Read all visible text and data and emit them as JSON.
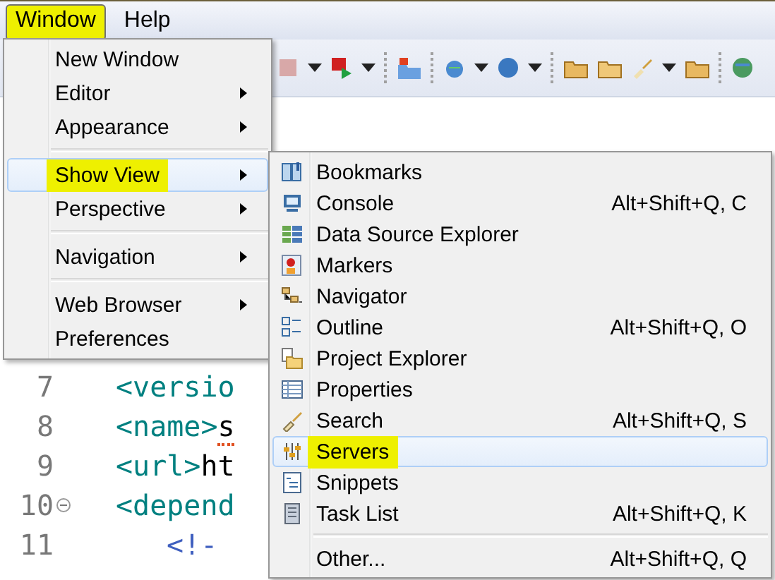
{
  "menubar": [
    {
      "label": "Window",
      "selected": true,
      "highlighted": true
    },
    {
      "label": "Help",
      "selected": false,
      "highlighted": false
    }
  ],
  "editor": {
    "lines": [
      {
        "number": "7",
        "tag": "<versio"
      },
      {
        "number": "8",
        "tag": "<name>",
        "text": "s",
        "squiggle": true
      },
      {
        "number": "9",
        "tag": "<url>",
        "text": "ht",
        "squiggle": false
      },
      {
        "number": "10",
        "tag": "<depend",
        "folded": true,
        "children": [
          {
            "number": "11",
            "tag": "<!-",
            "comment": true
          }
        ]
      }
    ]
  },
  "window_menu": {
    "items": [
      {
        "kind": "item",
        "label": "New Window",
        "submenu": false,
        "selected": false,
        "highlighted": false
      },
      {
        "kind": "item",
        "label": "Editor",
        "submenu": true,
        "selected": false,
        "highlighted": false
      },
      {
        "kind": "item",
        "label": "Appearance",
        "submenu": true,
        "selected": false,
        "highlighted": false
      },
      {
        "kind": "separator"
      },
      {
        "kind": "item",
        "label": "Show View",
        "submenu": true,
        "selected": true,
        "highlighted": true
      },
      {
        "kind": "item",
        "label": "Perspective",
        "submenu": true,
        "selected": false,
        "highlighted": false
      },
      {
        "kind": "separator"
      },
      {
        "kind": "item",
        "label": "Navigation",
        "submenu": true,
        "selected": false,
        "highlighted": false
      },
      {
        "kind": "separator"
      },
      {
        "kind": "item",
        "label": "Web Browser",
        "submenu": true,
        "selected": false,
        "highlighted": false
      },
      {
        "kind": "item",
        "label": "Preferences",
        "submenu": false,
        "selected": false,
        "highlighted": false
      }
    ]
  },
  "show_view_menu": {
    "items": [
      {
        "kind": "item",
        "label": "Bookmarks",
        "selected": false,
        "highlighted": false
      },
      {
        "kind": "item",
        "label": "Console",
        "shortcut": "Alt+Shift+Q, C",
        "selected": false,
        "highlighted": false
      },
      {
        "kind": "item",
        "label": "Data Source Explorer",
        "selected": false,
        "highlighted": false
      },
      {
        "kind": "item",
        "label": "Markers",
        "selected": false,
        "highlighted": false
      },
      {
        "kind": "item",
        "label": "Navigator",
        "selected": false,
        "highlighted": false
      },
      {
        "kind": "item",
        "label": "Outline",
        "shortcut": "Alt+Shift+Q, O",
        "selected": false,
        "highlighted": false
      },
      {
        "kind": "item",
        "label": "Project Explorer",
        "selected": false,
        "highlighted": false
      },
      {
        "kind": "item",
        "label": "Properties",
        "selected": false,
        "highlighted": false
      },
      {
        "kind": "item",
        "label": "Search",
        "shortcut": "Alt+Shift+Q, S",
        "selected": false,
        "highlighted": false
      },
      {
        "kind": "item",
        "label": "Servers",
        "selected": true,
        "highlighted": true
      },
      {
        "kind": "item",
        "label": "Snippets",
        "selected": false,
        "highlighted": false
      },
      {
        "kind": "item",
        "label": "Task List",
        "shortcut": "Alt+Shift+Q, K",
        "selected": false,
        "highlighted": false
      },
      {
        "kind": "separator"
      },
      {
        "kind": "item",
        "label": "Other...",
        "shortcut": "Alt+Shift+Q, Q",
        "selected": false,
        "highlighted": false
      }
    ]
  }
}
